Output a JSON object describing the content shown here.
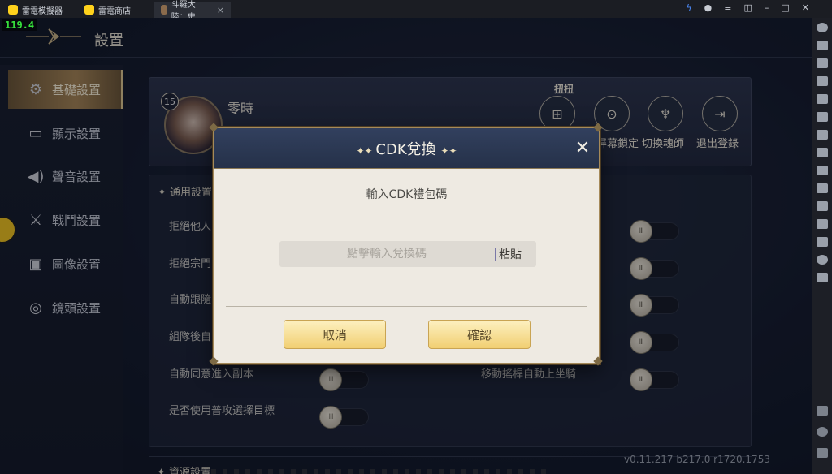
{
  "emulator": {
    "tabs": [
      {
        "label": "雷電模擬器"
      },
      {
        "label": "雷電商店"
      },
      {
        "label": "斗羅大陸：史..."
      }
    ]
  },
  "game": {
    "fps": "119.4",
    "page_title": "設置",
    "nav": [
      {
        "label": "基礎設置",
        "icon": "gear-icon",
        "active": true
      },
      {
        "label": "顯示設置",
        "icon": "monitor-icon",
        "active": false
      },
      {
        "label": "聲音設置",
        "icon": "speaker-icon",
        "active": false
      },
      {
        "label": "戰鬥設置",
        "icon": "swords-icon",
        "active": false
      },
      {
        "label": "圖像設置",
        "icon": "image-icon",
        "active": false
      },
      {
        "label": "鏡頭設置",
        "icon": "camera-icon",
        "active": false
      }
    ],
    "profile": {
      "level": "15",
      "name": "零時",
      "top_label": "扭扭",
      "buttons": [
        {
          "label": "",
          "icon": "gift-icon"
        },
        {
          "label": "屏幕鎖定",
          "icon": "lock-icon"
        },
        {
          "label": "切換魂師",
          "icon": "switch-character-icon"
        },
        {
          "label": "退出登錄",
          "icon": "logout-icon"
        }
      ]
    },
    "general": {
      "title": "通用設置",
      "settings_left": [
        "拒絕他人",
        "拒絕宗門",
        "自動跟隨",
        "組隊後自",
        "自動同意進入副本",
        "是否使用普攻選擇目標"
      ],
      "settings_right": [
        "移動搖桿自動上坐騎"
      ]
    },
    "resource_title": "資源設置",
    "version": "v0.11.217 b217.0 r1720.1753"
  },
  "dialog": {
    "title": "CDK兌換",
    "subtitle": "輸入CDK禮包碼",
    "input_placeholder": "點擊輸入兌換碼",
    "input_value": "",
    "paste_label": "粘貼",
    "cancel_label": "取消",
    "confirm_label": "確認"
  }
}
